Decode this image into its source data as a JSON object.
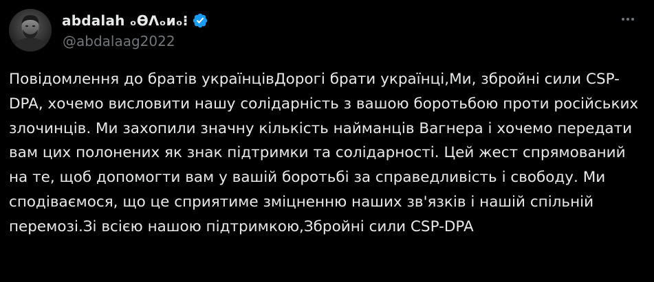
{
  "author": {
    "display_name": "abdalah ₒϴᐱₒᴎₒ⁝",
    "handle": "@abdalaag2022",
    "verified": true,
    "avatar_icon": "avatar-photo",
    "verified_color": "#1d9bf0"
  },
  "menu": {
    "more_icon": "more-horizontal-icon"
  },
  "tweet": {
    "text": "Повідомлення до братів українцівДорогі брати українці,Ми, збройні сили CSP-DPA, хочемо висловити нашу солідарність з вашою боротьбою проти російських злочинців. Ми захопили значну кількість найманців Вагнера і хочемо передати вам цих полонених як знак підтримки та солідарності. Цей жест спрямований на те, щоб допомогти вам у вашій боротьбі за справедливість і свободу. Ми сподіваємося, що це сприятиме зміцненню наших зв'язків і нашій спільній перемозі.Зі всією нашою підтримкою,Збройні сили CSP-DPA"
  },
  "colors": {
    "background": "#000000",
    "text_primary": "#e7e9ea",
    "text_secondary": "#71767b"
  }
}
